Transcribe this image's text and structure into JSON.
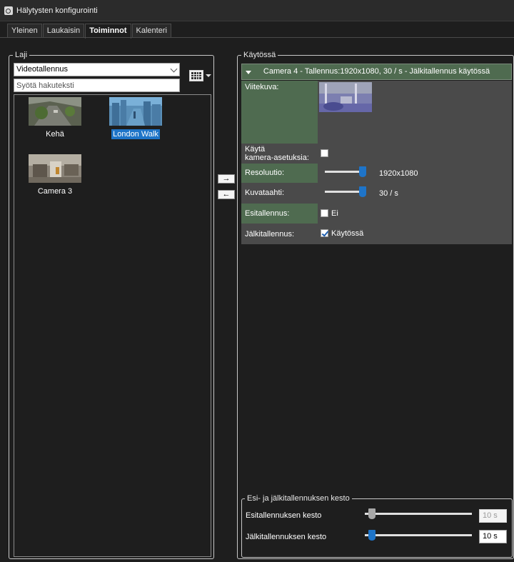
{
  "window": {
    "title": "Hälytysten konfigurointi",
    "icon": "settings-gear-icon"
  },
  "tabs": [
    {
      "label": "Yleinen",
      "active": false
    },
    {
      "label": "Laukaisin",
      "active": false
    },
    {
      "label": "Toiminnot",
      "active": true
    },
    {
      "label": "Kalenteri",
      "active": false
    }
  ],
  "left": {
    "legend": "Laji",
    "type_select": {
      "value": "Videotallennus"
    },
    "search": {
      "placeholder": "Syötä hakuteksti"
    },
    "items": [
      {
        "label": "Kehä",
        "selected": false
      },
      {
        "label": "London Walk",
        "selected": true
      },
      {
        "label": "Camera 3",
        "selected": false
      }
    ]
  },
  "transfer": {
    "add": "→",
    "remove": "←"
  },
  "right": {
    "legend": "Käytössä",
    "camera_header": "Camera 4 - Tallennus:1920x1080, 30 / s - Jälkitallennus käytössä",
    "props": {
      "preview_label": "Viitekuva:",
      "use_camera_label_1": "Käytä",
      "use_camera_label_2": "kamera-asetuksia:",
      "use_camera_checked": false,
      "resolution_label": "Resoluutio:",
      "resolution_value": "1920x1080",
      "resolution_level": 1.0,
      "framerate_label": "Kuvataahti:",
      "framerate_value": "30 / s",
      "framerate_level": 1.0,
      "prerecord_label": "Esitallennus:",
      "prerecord_checked": false,
      "prerecord_value": "Ei",
      "postrecord_label": "Jälkitallennus:",
      "postrecord_checked": true,
      "postrecord_value": "Käytössä"
    },
    "duration": {
      "legend": "Esi- ja jälkitallennuksen kesto",
      "pre_label": "Esitallennuksen kesto",
      "pre_value": "10 s",
      "pre_enabled": false,
      "post_label": "Jälkitallennuksen kesto",
      "post_value": "10 s",
      "post_enabled": true
    }
  },
  "colors": {
    "accent": "#1e74c8",
    "header_green": "#4f6b50",
    "background": "#1e1e1e"
  }
}
